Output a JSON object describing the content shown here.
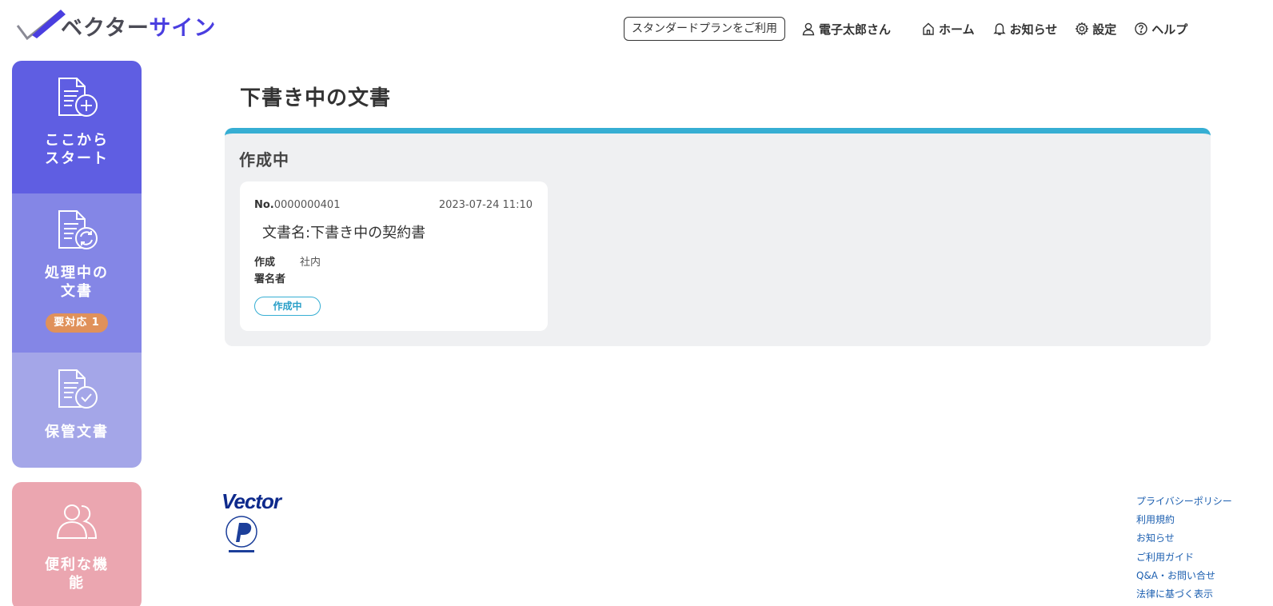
{
  "header": {
    "logo": {
      "part1": "ベクター",
      "part2": "サイン"
    },
    "plan_badge": "スタンダードプランをご利用",
    "user_name": "電子太郎さん",
    "nav": [
      {
        "label": "ホーム",
        "icon": "home-icon"
      },
      {
        "label": "お知らせ",
        "icon": "bell-icon"
      },
      {
        "label": "設定",
        "icon": "gear-icon"
      },
      {
        "label": "ヘルプ",
        "icon": "help-icon"
      }
    ]
  },
  "sidebar": {
    "start": {
      "label": "ここから\nスタート",
      "icon": "document-add-icon"
    },
    "processing": {
      "label": "処理中の\n文書",
      "icon": "document-sync-icon",
      "badge": "要対応 1"
    },
    "storage": {
      "label": "保管文書",
      "icon": "document-check-icon"
    },
    "convenient": {
      "label": "便利な機\n能",
      "icon": "users-icon"
    }
  },
  "main": {
    "title": "下書き中の文書",
    "panel_title": "作成中",
    "card": {
      "no_prefix": "No.",
      "no": "0000000401",
      "date": "2023-07-24 11:10",
      "name": "文書名:下書き中の契約書",
      "creator_label": "作成",
      "creator_value": "社内",
      "signer_label": "署名者",
      "signer_value": "",
      "status": "作成中"
    }
  },
  "footer": {
    "company_logo": "Vector",
    "links": [
      "プライバシーポリシー",
      "利用規約",
      "お知らせ",
      "ご利用ガイド",
      "Q&A・お問い合せ",
      "法律に基づく表示"
    ]
  },
  "colors": {
    "brand": "#4a3ee0",
    "sidebar_start": "#5f5ee2",
    "sidebar_processing": "#8486e6",
    "sidebar_storage": "#a4a6e8",
    "sidebar_convenient": "#eba6b0",
    "badge": "#e0915a",
    "panel_accent": "#36aed3",
    "link": "#1c5fb0"
  }
}
